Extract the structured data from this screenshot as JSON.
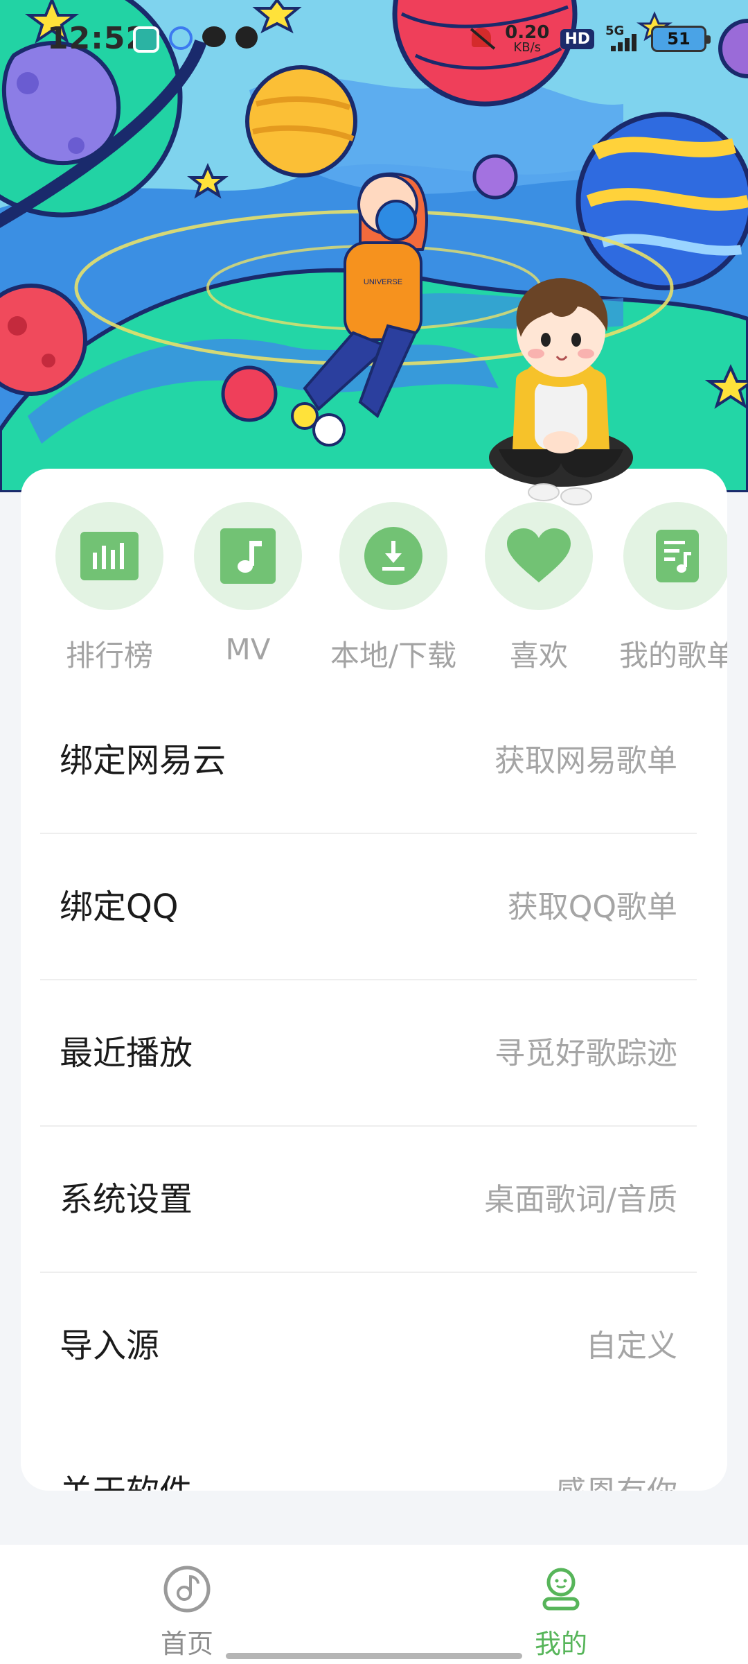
{
  "status_bar": {
    "time": "12:52",
    "net_speed_value": "0.20",
    "net_speed_unit": "KB/s",
    "hd_label": "HD",
    "signal_label": "5G",
    "battery_level": "51",
    "icons": [
      "app-icon-1",
      "app-icon-2",
      "app-icon-3",
      "app-icon-4",
      "bell-muted-icon",
      "signal-icon",
      "battery-icon"
    ]
  },
  "quick_actions": [
    {
      "label": "排行榜",
      "icon": "chart-bars-icon"
    },
    {
      "label": "MV",
      "icon": "music-note-icon"
    },
    {
      "label": "本地/下载",
      "icon": "download-icon"
    },
    {
      "label": "喜欢",
      "icon": "heart-icon"
    },
    {
      "label": "我的歌单",
      "icon": "playlist-icon"
    }
  ],
  "menu": [
    {
      "title": "绑定网易云",
      "subtitle": "获取网易歌单"
    },
    {
      "title": "绑定QQ",
      "subtitle": "获取QQ歌单"
    },
    {
      "title": "最近播放",
      "subtitle": "寻觅好歌踪迹"
    },
    {
      "title": "系统设置",
      "subtitle": "桌面歌词/音质"
    },
    {
      "title": "导入源",
      "subtitle": "自定义"
    },
    {
      "title": "关于软件",
      "subtitle": "感恩有你"
    }
  ],
  "nav": {
    "home_label": "首页",
    "mine_label": "我的",
    "active": "我的"
  },
  "colors": {
    "accent": "#57b55a",
    "icon_tile": "#72c274",
    "icon_circle_bg": "#e3f3e3",
    "sky": "#7fd3ee"
  }
}
